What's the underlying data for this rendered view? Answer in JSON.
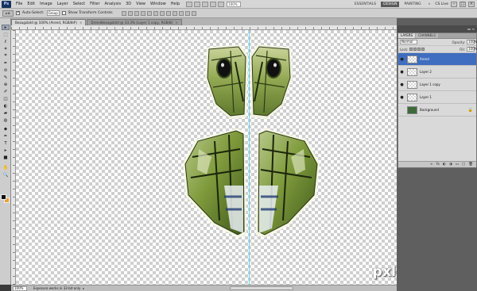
{
  "app": {
    "logo": "Ps",
    "menus": [
      "File",
      "Edit",
      "Image",
      "Layer",
      "Select",
      "Filter",
      "Analysis",
      "3D",
      "View",
      "Window",
      "Help"
    ],
    "zoom": "100%",
    "workspaces": [
      "ESSENTIALS",
      "DESIGN",
      "PAINTING"
    ],
    "active_workspace": "DESIGN",
    "more": "»",
    "cs_live": "CS Live",
    "window_buttons": [
      "–",
      "□",
      "×"
    ]
  },
  "options": {
    "tool": "▸⊕",
    "auto_select_label": "Auto-Select:",
    "auto_select_value": "Group",
    "transform_label": "Show Transform Controls"
  },
  "tabs": [
    {
      "label": "Bezugsbild @ 100% (Arend, RGB/8#)",
      "close": "×"
    },
    {
      "label": "DroneBezugsbild @ 33.3% (Layer 1 copy, RGB/8)",
      "close": "×"
    }
  ],
  "tools": [
    "▸",
    "⬚",
    "ℓ",
    "✶",
    "⌗",
    "✒",
    "⊘",
    "✎",
    "⊕",
    "✐",
    "◫",
    "◐",
    "▰",
    "◍",
    "◆",
    "✒",
    "T",
    "▸",
    "■",
    "✋",
    "🔍"
  ],
  "layers_panel": {
    "tabs": [
      "LAYERS",
      "CHANNELS"
    ],
    "blend_mode": "Normal",
    "opacity_label": "Opacity:",
    "opacity": "100%",
    "lock_label": "Lock:",
    "fill_label": "Fill:",
    "fill": "100%",
    "collapse": "▸▸ ≡",
    "layers": [
      {
        "name": "Arend",
        "active": true,
        "eye": "●"
      },
      {
        "name": "Layer 2",
        "active": false,
        "eye": "●"
      },
      {
        "name": "Layer 1 copy",
        "active": false,
        "eye": "●"
      },
      {
        "name": "Layer 1",
        "active": false,
        "eye": "●"
      },
      {
        "name": "Background",
        "active": false,
        "eye": "",
        "locked": true
      }
    ],
    "footer_icons": [
      "∞",
      "fx",
      "◐",
      "◑",
      "▭",
      "▢",
      "🗑"
    ],
    "lock_mark": "🔒"
  },
  "status": {
    "zoom": "100%",
    "info": "Exposure works in 32-bit only",
    "arrow": "▸"
  },
  "watermark": "pxleyes.com"
}
